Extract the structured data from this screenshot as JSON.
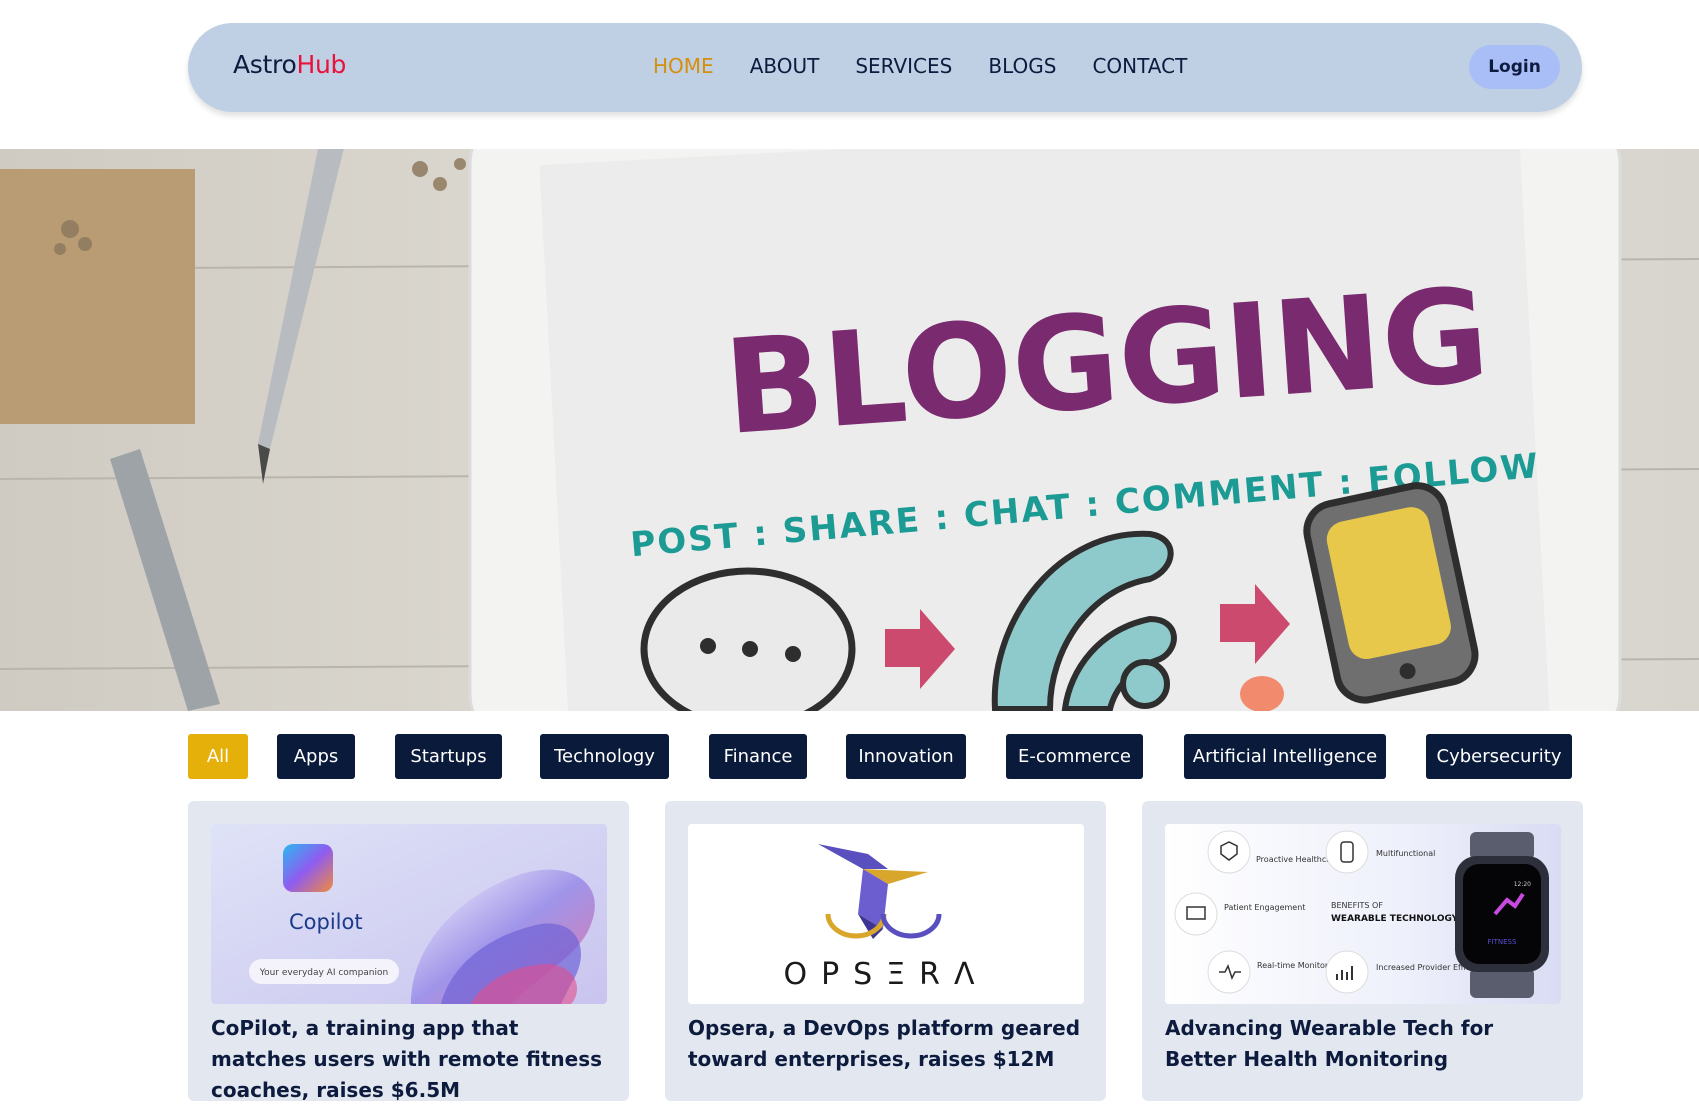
{
  "brand": {
    "part1": "Astro",
    "part2": "Hub"
  },
  "nav": {
    "links": [
      {
        "label": "HOME",
        "active": true
      },
      {
        "label": "ABOUT"
      },
      {
        "label": "SERVICES"
      },
      {
        "label": "BLOGS"
      },
      {
        "label": "CONTACT"
      }
    ],
    "login": "Login"
  },
  "hero": {
    "title": "BLOGGING",
    "tagline": "POST : SHARE : CHAT : COMMENT : FOLLOW"
  },
  "filters": [
    {
      "label": "All",
      "active": true
    },
    {
      "label": "Apps"
    },
    {
      "label": "Startups"
    },
    {
      "label": "Technology"
    },
    {
      "label": "Finance"
    },
    {
      "label": "Innovation"
    },
    {
      "label": "E-commerce"
    },
    {
      "label": "Artificial Intelligence"
    },
    {
      "label": "Cybersecurity"
    }
  ],
  "cards": [
    {
      "title": "CoPilot, a training app that matches users with remote fitness coaches, raises $6.5M",
      "thumb": {
        "name": "Copilot",
        "tagline": "Your everyday AI companion"
      }
    },
    {
      "title": "Opsera, a DevOps platform geared toward enterprises, raises $12M",
      "thumb": {
        "name": "OPSΞRΛ"
      }
    },
    {
      "title": "Advancing Wearable Tech for Better Health Monitoring",
      "thumb": {
        "heading1": "BENEFITS OF",
        "heading2": "WEARABLE TECHNOLOGY",
        "items": [
          "Proactive Healthcare",
          "Multifunctional",
          "Patient Engagement",
          "Real-time Monitoring",
          "Increased Provider Efficiency"
        ],
        "watch_time": "12:20",
        "watch_label": "FITNESS"
      }
    }
  ],
  "colors": {
    "navbar_bg": "#bfcfe4",
    "active_nav": "#d4900d",
    "brand_accent": "#e8123c",
    "chip_bg": "#0a1a3a",
    "chip_active": "#e5b009",
    "login_bg": "#a9bef7"
  }
}
